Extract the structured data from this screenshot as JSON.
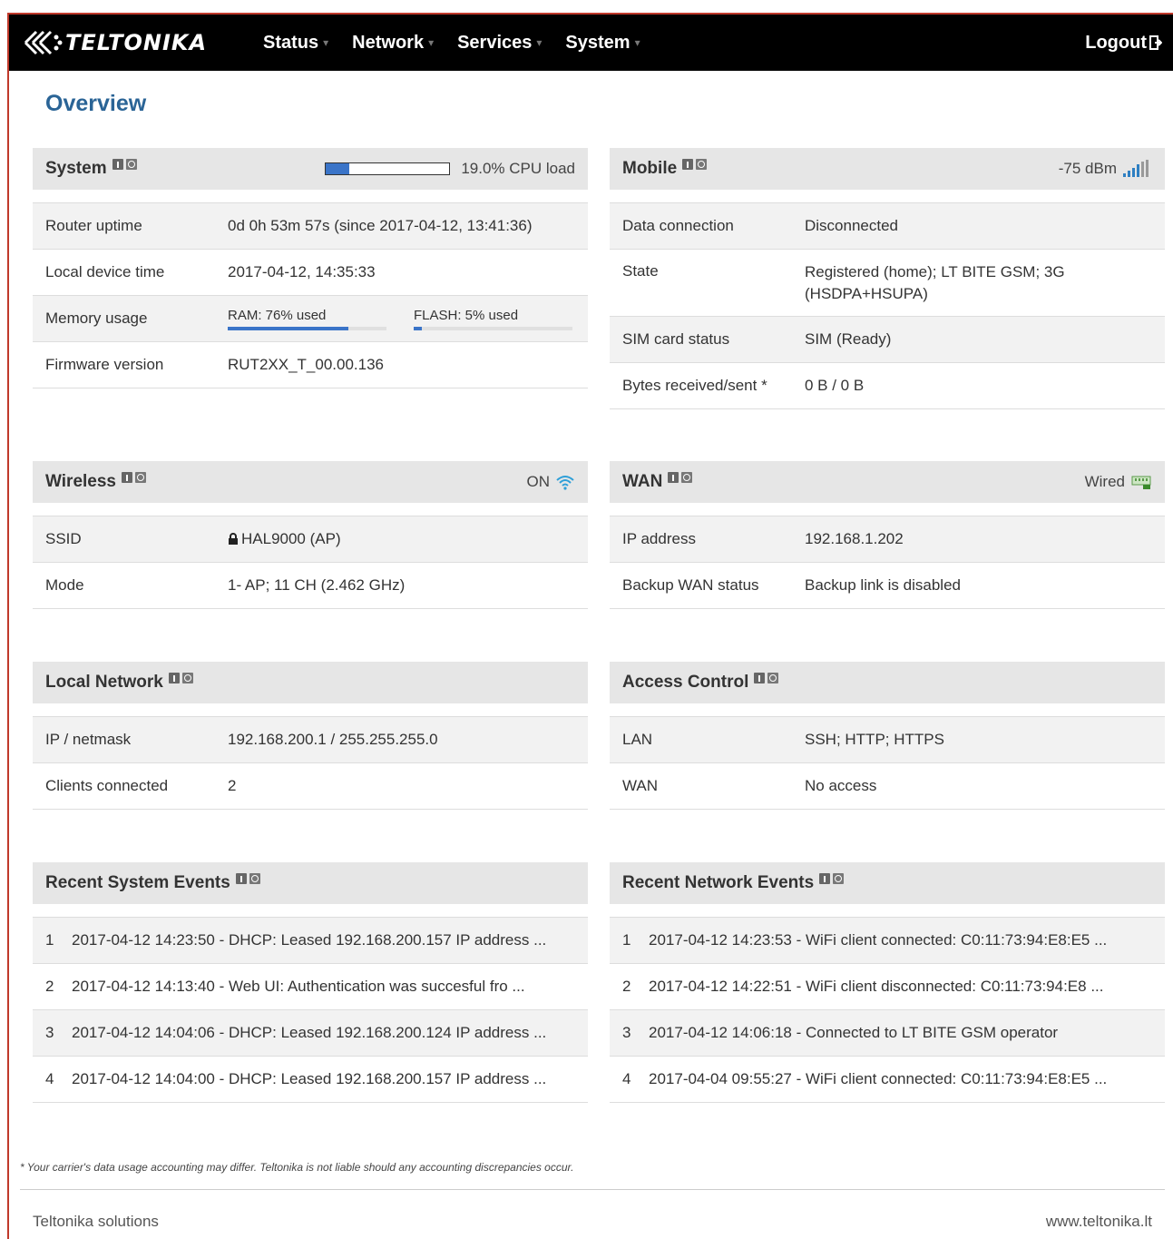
{
  "brand": {
    "logo_text": "TELTONIKA"
  },
  "nav": {
    "items": [
      {
        "label": "Status"
      },
      {
        "label": "Network"
      },
      {
        "label": "Services"
      },
      {
        "label": "System"
      }
    ],
    "logout_label": "Logout"
  },
  "page": {
    "title": "Overview"
  },
  "system": {
    "title": "System",
    "cpu_load_label": "19.0% CPU load",
    "cpu_load_fraction": 0.19,
    "rows": [
      {
        "label": "Router uptime",
        "value": "0d 0h 53m 57s (since 2017-04-12, 13:41:36)"
      },
      {
        "label": "Local device time",
        "value": "2017-04-12, 14:35:33"
      },
      {
        "label": "Memory usage",
        "ram_label": "RAM: 76% used",
        "ram_fraction": 0.76,
        "flash_label": "FLASH: 5% used",
        "flash_fraction": 0.05
      },
      {
        "label": "Firmware version",
        "value": "RUT2XX_T_00.00.136"
      }
    ]
  },
  "mobile": {
    "title": "Mobile",
    "signal": "-75 dBm",
    "rows": [
      {
        "label": "Data connection",
        "value": "Disconnected"
      },
      {
        "label": "State",
        "value": "Registered (home); LT BITE GSM; 3G (HSDPA+HSUPA)"
      },
      {
        "label": "SIM card status",
        "value": "SIM (Ready)"
      },
      {
        "label": "Bytes received/sent *",
        "value": "0 B / 0 B"
      }
    ]
  },
  "wireless": {
    "title": "Wireless",
    "status": "ON",
    "rows": [
      {
        "label": "SSID",
        "value": "HAL9000 (AP)"
      },
      {
        "label": "Mode",
        "value": "1- AP; 11 CH (2.462 GHz)"
      }
    ]
  },
  "wan": {
    "title": "WAN",
    "status": "Wired",
    "rows": [
      {
        "label": "IP address",
        "value": "192.168.1.202"
      },
      {
        "label": "Backup WAN status",
        "value": "Backup link is disabled"
      }
    ]
  },
  "local_network": {
    "title": "Local Network",
    "rows": [
      {
        "label": "IP / netmask",
        "value": "192.168.200.1 / 255.255.255.0"
      },
      {
        "label": "Clients connected",
        "value": "2"
      }
    ]
  },
  "access_control": {
    "title": "Access Control",
    "rows": [
      {
        "label": "LAN",
        "value": "SSH; HTTP; HTTPS"
      },
      {
        "label": "WAN",
        "value": "No access"
      }
    ]
  },
  "system_events": {
    "title": "Recent System Events",
    "items": [
      {
        "num": "1",
        "text": "2017-04-12 14:23:50 - DHCP: Leased 192.168.200.157 IP address ..."
      },
      {
        "num": "2",
        "text": "2017-04-12 14:13:40 - Web UI: Authentication was succesful fro ..."
      },
      {
        "num": "3",
        "text": "2017-04-12 14:04:06 - DHCP: Leased 192.168.200.124 IP address ..."
      },
      {
        "num": "4",
        "text": "2017-04-12 14:04:00 - DHCP: Leased 192.168.200.157 IP address ..."
      }
    ]
  },
  "network_events": {
    "title": "Recent Network Events",
    "items": [
      {
        "num": "1",
        "text": "2017-04-12 14:23:53 - WiFi client connected: C0:11:73:94:E8:E5 ..."
      },
      {
        "num": "2",
        "text": "2017-04-12 14:22:51 - WiFi client disconnected: C0:11:73:94:E8 ..."
      },
      {
        "num": "3",
        "text": "2017-04-12 14:06:18 - Connected to LT BITE GSM operator"
      },
      {
        "num": "4",
        "text": "2017-04-04 09:55:27 - WiFi client connected: C0:11:73:94:E8:E5 ..."
      }
    ]
  },
  "footer": {
    "note": "* Your carrier's data usage accounting may differ. Teltonika is not liable should any accounting discrepancies occur.",
    "left": "Teltonika solutions",
    "right": "www.teltonika.lt"
  },
  "colors": {
    "accent": "#2a6496",
    "bar": "#3a74c8",
    "wifi": "#2e9fd8"
  }
}
